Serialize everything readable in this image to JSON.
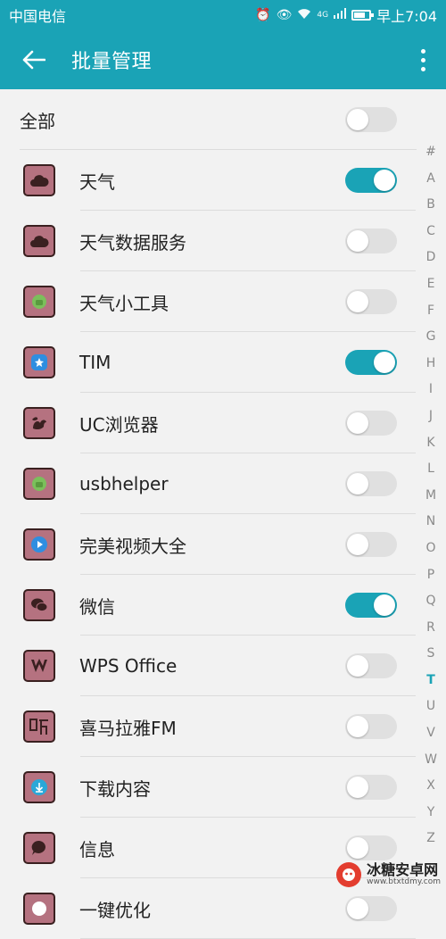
{
  "status": {
    "carrier": "中国电信",
    "network": "4G",
    "time": "早上7:04",
    "battery_level": 0.75
  },
  "appbar": {
    "title": "批量管理"
  },
  "select_all": {
    "label": "全部",
    "enabled": false
  },
  "apps": [
    {
      "name": "天气",
      "icon": "cloud-icon",
      "enabled": true
    },
    {
      "name": "天气数据服务",
      "icon": "cloud-icon",
      "enabled": false
    },
    {
      "name": "天气小工具",
      "icon": "android-icon",
      "enabled": false
    },
    {
      "name": "TIM",
      "icon": "tim-icon",
      "enabled": true
    },
    {
      "name": "UC浏览器",
      "icon": "squirrel-icon",
      "enabled": false
    },
    {
      "name": "usbhelper",
      "icon": "android-icon",
      "enabled": false
    },
    {
      "name": "完美视频大全",
      "icon": "play-icon",
      "enabled": false
    },
    {
      "name": "微信",
      "icon": "wechat-icon",
      "enabled": true
    },
    {
      "name": "WPS Office",
      "icon": "wps-icon",
      "enabled": false
    },
    {
      "name": "喜马拉雅FM",
      "icon": "ting-icon",
      "enabled": false
    },
    {
      "name": "下载内容",
      "icon": "download-icon",
      "enabled": false
    },
    {
      "name": "信息",
      "icon": "message-icon",
      "enabled": false
    },
    {
      "name": "一键优化",
      "icon": "optimize-icon",
      "enabled": false
    }
  ],
  "index_letters": [
    "#",
    "A",
    "B",
    "C",
    "D",
    "E",
    "F",
    "G",
    "H",
    "I",
    "J",
    "K",
    "L",
    "M",
    "N",
    "O",
    "P",
    "Q",
    "R",
    "S",
    "T",
    "U",
    "V",
    "W",
    "X",
    "Y",
    "Z"
  ],
  "active_letter": "T",
  "watermark": {
    "name": "冰糖安卓网",
    "url": "www.btxtdmy.com"
  },
  "colors": {
    "accent": "#1aa3b6",
    "icon_bg": "#b57280"
  }
}
